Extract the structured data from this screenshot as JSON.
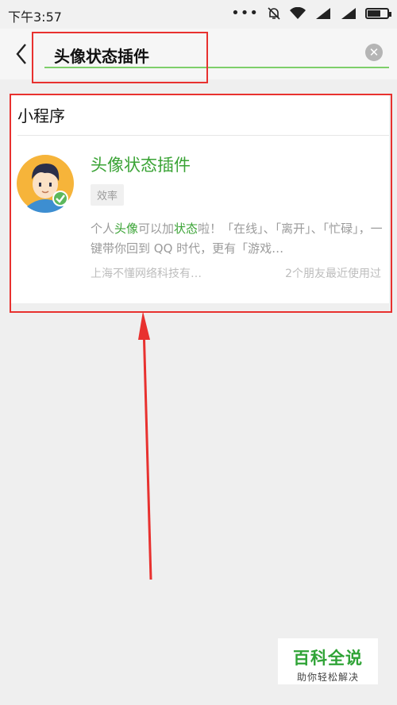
{
  "status": {
    "time": "下午3:57",
    "dots": "•••"
  },
  "search": {
    "query": "头像状态插件",
    "clear_icon": "close-circle-icon",
    "back_icon": "chevron-left-icon"
  },
  "section": {
    "title": "小程序"
  },
  "result": {
    "name": "头像状态插件",
    "tag": "效率",
    "desc_1": "个人",
    "desc_hl1": "头像",
    "desc_2": "可以加",
    "desc_hl2": "状态",
    "desc_3": "啦！「在线」、「离开」、「忙碌」，一键带你回到 QQ 时代，更有「游戏…",
    "company": "上海不懂网络科技有…",
    "usage": "2个朋友最近使用过"
  },
  "watermark": {
    "title": "百科全说",
    "subtitle": "助你轻松解决"
  },
  "colors": {
    "accent": "#3aa335",
    "annotation": "#e8312f"
  }
}
